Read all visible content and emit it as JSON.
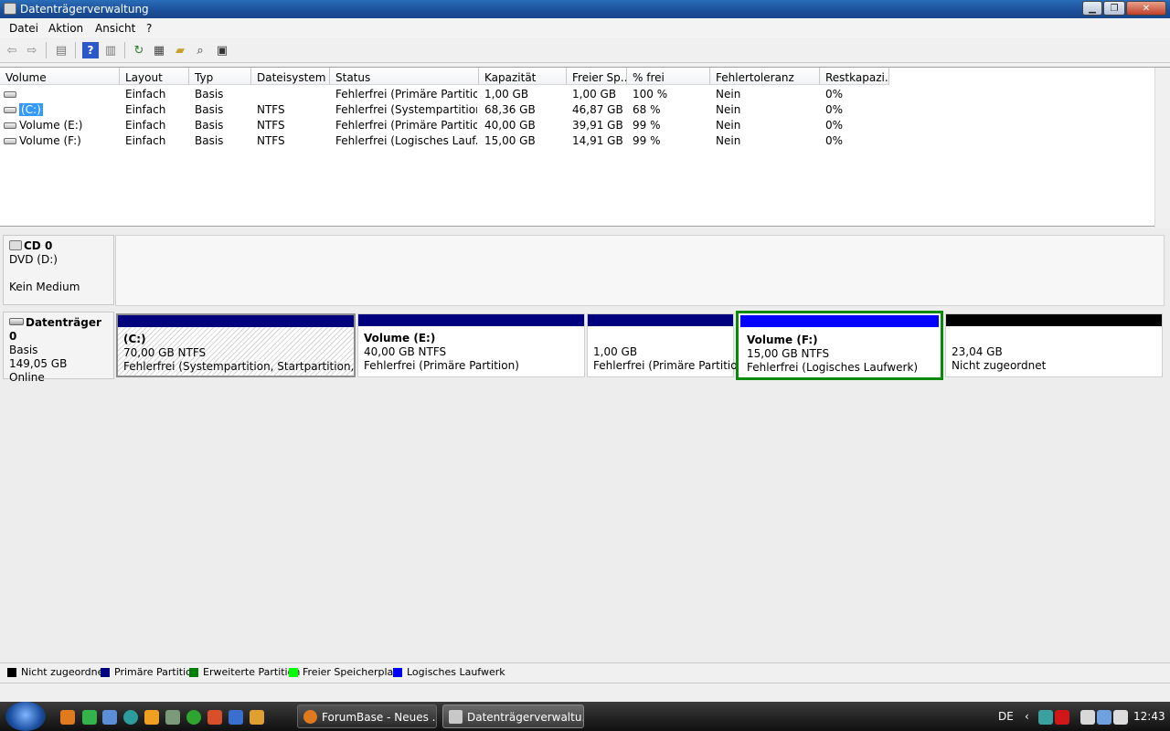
{
  "window": {
    "title": "Datenträgerverwaltung"
  },
  "menu": [
    "Datei",
    "Aktion",
    "Ansicht",
    "?"
  ],
  "volumes": {
    "columns": [
      "Volume",
      "Layout",
      "Typ",
      "Dateisystem",
      "Status",
      "Kapazität",
      "Freier Sp...",
      "% frei",
      "Fehlertoleranz",
      "Restkapazi..."
    ],
    "rows": [
      [
        "",
        "Einfach",
        "Basis",
        "",
        "Fehlerfrei (Primäre Partition)",
        "1,00 GB",
        "1,00 GB",
        "100 %",
        "Nein",
        "0%"
      ],
      [
        "(C:)",
        "Einfach",
        "Basis",
        "NTFS",
        "Fehlerfrei (Systempartition,...",
        "68,36 GB",
        "46,87 GB",
        "68 %",
        "Nein",
        "0%"
      ],
      [
        "Volume (E:)",
        "Einfach",
        "Basis",
        "NTFS",
        "Fehlerfrei (Primäre Partition)",
        "40,00 GB",
        "39,91 GB",
        "99 %",
        "Nein",
        "0%"
      ],
      [
        "Volume (F:)",
        "Einfach",
        "Basis",
        "NTFS",
        "Fehlerfrei (Logisches Lauf...",
        "15,00 GB",
        "14,91 GB",
        "99 %",
        "Nein",
        "0%"
      ]
    ]
  },
  "cd0": {
    "name": "CD 0",
    "type": "DVD (D:)",
    "status": "Kein Medium"
  },
  "disk0": {
    "name": "Datenträger 0",
    "type": "Basis",
    "size": "149,05 GB",
    "status": "Online"
  },
  "partitions": [
    {
      "name": "(C:)",
      "size": "70,00 GB NTFS",
      "status": "Fehlerfrei (Systempartition, Startpartition, Ausla",
      "color": "#00007f"
    },
    {
      "name": "Volume  (E:)",
      "size": "40,00 GB NTFS",
      "status": "Fehlerfrei (Primäre Partition)",
      "color": "#00007f"
    },
    {
      "name": "",
      "size": "1,00 GB",
      "status": "Fehlerfrei (Primäre Partition)",
      "color": "#00007f"
    },
    {
      "name": "Volume  (F:)",
      "size": "15,00 GB NTFS",
      "status": "Fehlerfrei (Logisches Laufwerk)",
      "color": "#0000ff"
    },
    {
      "name": "",
      "size": "23,04 GB",
      "status": "Nicht zugeordnet",
      "color": "#000000"
    }
  ],
  "legend": [
    {
      "label": "Nicht zugeordnet",
      "color": "#000000"
    },
    {
      "label": "Primäre Partition",
      "color": "#00007f"
    },
    {
      "label": "Erweiterte Partition",
      "color": "#008000"
    },
    {
      "label": "Freier Speicherplatz",
      "color": "#00ff00"
    },
    {
      "label": "Logisches Laufwerk",
      "color": "#0000ff"
    }
  ],
  "taskbar": {
    "tasks": [
      "ForumBase - Neues ...",
      "Datenträgerverwaltu..."
    ],
    "lang": "DE",
    "clock": "12:43"
  }
}
